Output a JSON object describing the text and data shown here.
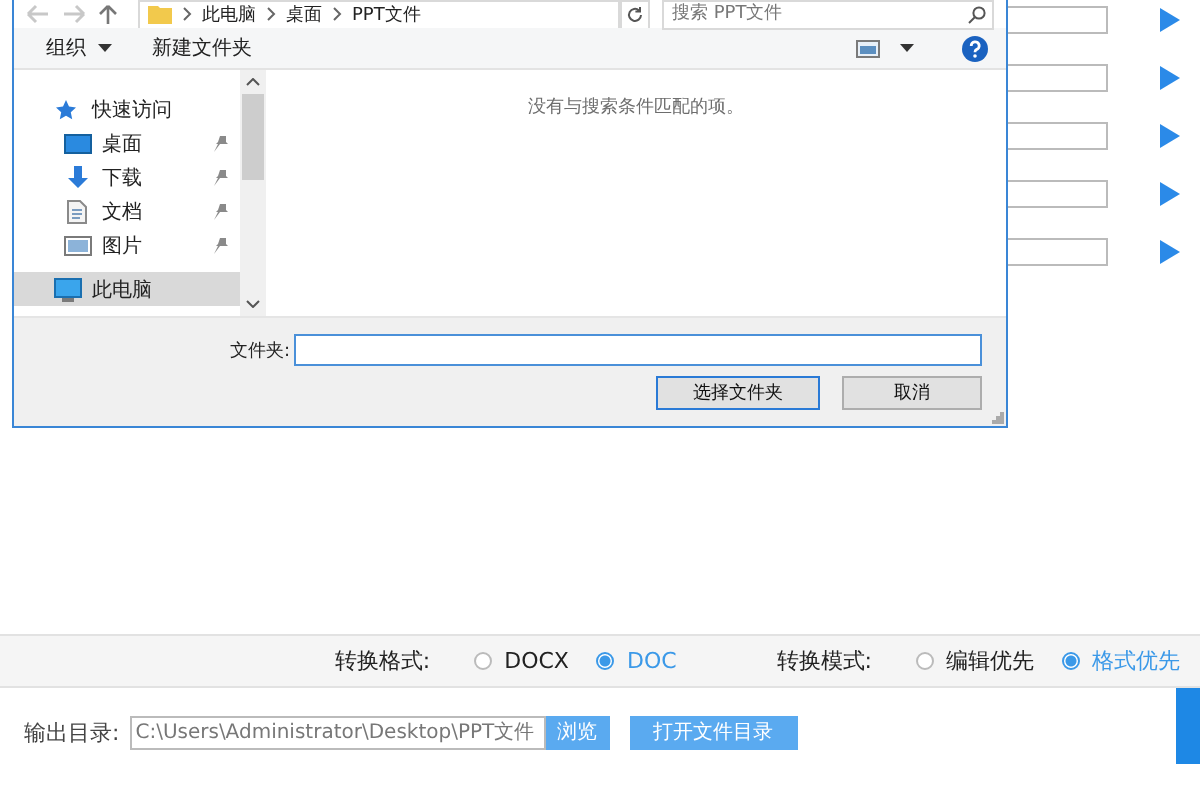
{
  "dialog": {
    "address": {
      "path": [
        "此电脑",
        "桌面",
        "PPT文件"
      ],
      "search_placeholder": "搜索 PPT文件"
    },
    "toolbar": {
      "organize": "组织",
      "new_folder": "新建文件夹"
    },
    "nav": [
      {
        "label": "快速访问",
        "pinned": false,
        "selected": false
      },
      {
        "label": "桌面",
        "pinned": true,
        "selected": false
      },
      {
        "label": "下载",
        "pinned": true,
        "selected": false
      },
      {
        "label": "文档",
        "pinned": true,
        "selected": false
      },
      {
        "label": "图片",
        "pinned": true,
        "selected": false
      },
      {
        "label": "此电脑",
        "pinned": false,
        "selected": true
      }
    ],
    "empty_message": "没有与搜索条件匹配的项。",
    "folder_label": "文件夹:",
    "buttons": [
      {
        "label": "选择文件夹",
        "default": true
      },
      {
        "label": "取消",
        "default": false
      }
    ]
  },
  "options": {
    "format_label": "转换格式:",
    "formats": [
      {
        "label": "DOCX",
        "selected": false
      },
      {
        "label": "DOC",
        "selected": true
      }
    ],
    "mode_label": "转换模式:",
    "modes": [
      {
        "label": "编辑优先",
        "selected": false
      },
      {
        "label": "格式优先",
        "selected": true
      }
    ]
  },
  "output": {
    "label": "输出目录:",
    "path": "C:\\Users\\Administrator\\Desktop\\PPT文件",
    "browse": "浏览",
    "open": "打开文件目录"
  }
}
